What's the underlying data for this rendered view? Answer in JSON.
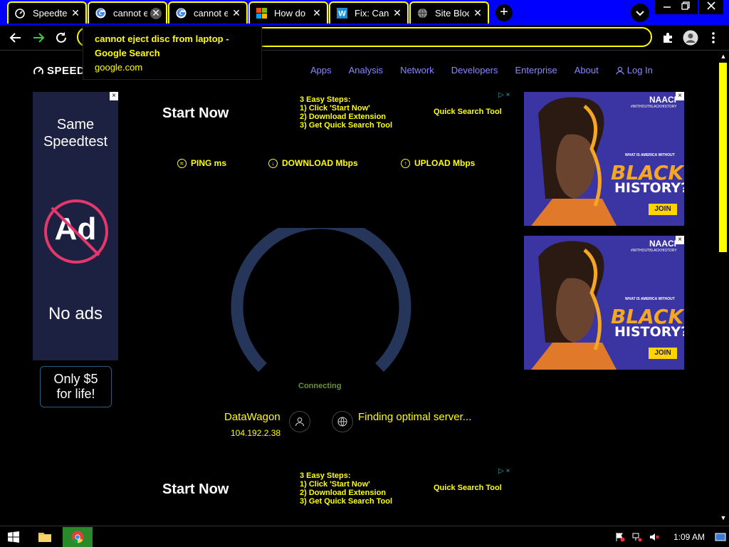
{
  "browser": {
    "tabs": [
      {
        "title": "Speedtest",
        "favicon": "speedtest-icon",
        "active": false
      },
      {
        "title": "cannot eject",
        "favicon": "google-icon",
        "active": true
      },
      {
        "title": "cannot eject",
        "favicon": "google-icon",
        "active": false
      },
      {
        "title": "How do I",
        "favicon": "microsoft-icon",
        "active": false
      },
      {
        "title": "Fix: Can't",
        "favicon": "w-icon",
        "active": false
      },
      {
        "title": "Site Block",
        "favicon": "globe-icon",
        "active": false
      }
    ],
    "new_tab": "+",
    "tooltip": {
      "title": "cannot eject disc from laptop - Google Search",
      "domain": "google.com"
    }
  },
  "page": {
    "logo": "SPEED",
    "nav": [
      "Apps",
      "Analysis",
      "Network",
      "Developers",
      "Enterprise",
      "About"
    ],
    "login": "Log In",
    "left_ad": {
      "line1": "Same",
      "line2": "Speedtest",
      "ad_mark": "Ad",
      "no_ads": "No ads",
      "close": "×"
    },
    "only5": {
      "line1": "Only $5",
      "line2": "for life!"
    },
    "center_ad": {
      "start": "Start Now",
      "steps_title": "3 Easy Steps:",
      "step1": "1)  Click 'Start Now'",
      "step2": "2)  Download Extension",
      "step3": "3)  Get Quick Search Tool",
      "tool": "Quick Search Tool",
      "ad_badge": "▷ ×"
    },
    "metrics": {
      "ping": "PING ms",
      "download": "DOWNLOAD Mbps",
      "upload": "UPLOAD Mbps"
    },
    "status": "Connecting",
    "isp": "DataWagon",
    "ip": "104.192.2.38",
    "server": "Finding optimal server..."
  },
  "right_ad": {
    "brand": "NAACP",
    "tag": "#WITHOUTBLACKHISTORY",
    "question": "WHAT IS AMERICA WITHOUT",
    "black": "BLACK",
    "history": "HISTORY?",
    "join": "JOIN",
    "close": "×"
  },
  "taskbar": {
    "clock": "1:09 AM"
  },
  "colors": {
    "accent": "#ffff00",
    "tabstrip": "#0000ff",
    "nav": "#8888ff",
    "gauge": "#26365a"
  }
}
